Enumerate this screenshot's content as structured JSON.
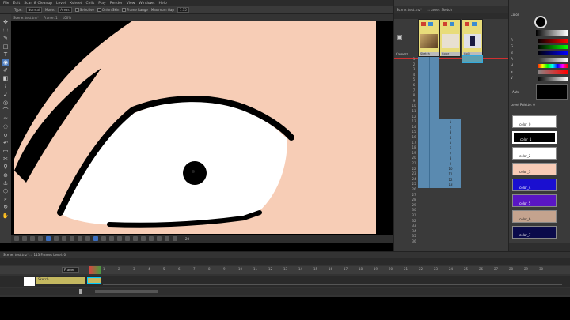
{
  "menubar": {
    "items": [
      "File",
      "Edit",
      "Scan & Cleanup",
      "Level",
      "Xsheet",
      "Cells",
      "Play",
      "Render",
      "View",
      "Windows",
      "Help"
    ],
    "rooms": [
      "Basics",
      "Cleanup",
      "Animation",
      "Palette",
      "Xsheet",
      "Timing",
      "Browser",
      "Farm"
    ],
    "active_room": "Basics"
  },
  "tool_options": {
    "type_label": "Type:",
    "type_value": "Normal",
    "mode_label": "Mode:",
    "mode_value": "Areas",
    "selective_label": "Selective",
    "onion_skin_label": "Onion Skin",
    "frame_range_label": "Frame Range",
    "max_gap_label": "Maximum Gap",
    "max_gap_value": "1.15"
  },
  "viewer": {
    "title": "Scene: test.tnz*",
    "frame": "Frame: 1",
    "zoom_readout": "100%",
    "zoom_value": "20"
  },
  "xsheet": {
    "title": "Scene: test.tnz*",
    "frame_info": "::: Level: Sketch",
    "camera_label": "Camera",
    "columns": [
      {
        "name": "Sketch",
        "color": "#f0e27a"
      },
      {
        "name": "Color",
        "color": "#f0e27a"
      },
      {
        "name": "Col3",
        "color": "#f0e27a"
      }
    ],
    "frames": [
      "1",
      "2",
      "3",
      "4",
      "5",
      "6",
      "7",
      "8",
      "9",
      "10",
      "11",
      "12",
      "13",
      "14",
      "15",
      "16",
      "17",
      "18",
      "19",
      "20",
      "21",
      "22",
      "23",
      "24",
      "25",
      "26",
      "27",
      "28",
      "29",
      "30",
      "31",
      "32",
      "33",
      "34",
      "35",
      "36"
    ],
    "cells_col2": [
      "1",
      "2",
      "3",
      "4",
      "5",
      "6",
      "7",
      "8",
      "9",
      "10",
      "11",
      "12",
      "13"
    ]
  },
  "style_editor": {
    "title": "Color",
    "auto_label": "Auto",
    "channels": [
      "R",
      "G",
      "B",
      "A",
      "H",
      "S",
      "V"
    ],
    "palette_title": "Level Palette: 0",
    "styles": [
      {
        "name": "color_0",
        "color": "#ffffff"
      },
      {
        "name": "color_1",
        "color": "#000000"
      },
      {
        "name": "color_2",
        "color": "#ffffff"
      },
      {
        "name": "color_3",
        "color": "#f8cbb6"
      },
      {
        "name": "color_4",
        "color": "#1a0fd0"
      },
      {
        "name": "color_5",
        "color": "#5a16c4"
      },
      {
        "name": "color_6",
        "color": "#c4a38e"
      },
      {
        "name": "color_7",
        "color": "#0a0a4a"
      }
    ]
  },
  "timeline": {
    "header": "Scene: test.tnz*  ::: 113 Frames  Level: 0",
    "layer_label": "Frame",
    "layer_name": "Sketch",
    "numbers": [
      "1",
      "2",
      "3",
      "4",
      "5",
      "6",
      "7",
      "8",
      "9",
      "10",
      "11",
      "12",
      "13",
      "14",
      "15",
      "16",
      "17",
      "18",
      "19",
      "20",
      "21",
      "22",
      "23",
      "24",
      "25",
      "26",
      "27",
      "28",
      "29",
      "30"
    ]
  },
  "colors": {
    "skin": "#f7cdb6",
    "eye_white": "#ffffff",
    "ink": "#000000",
    "accent": "#2a6fc4"
  }
}
